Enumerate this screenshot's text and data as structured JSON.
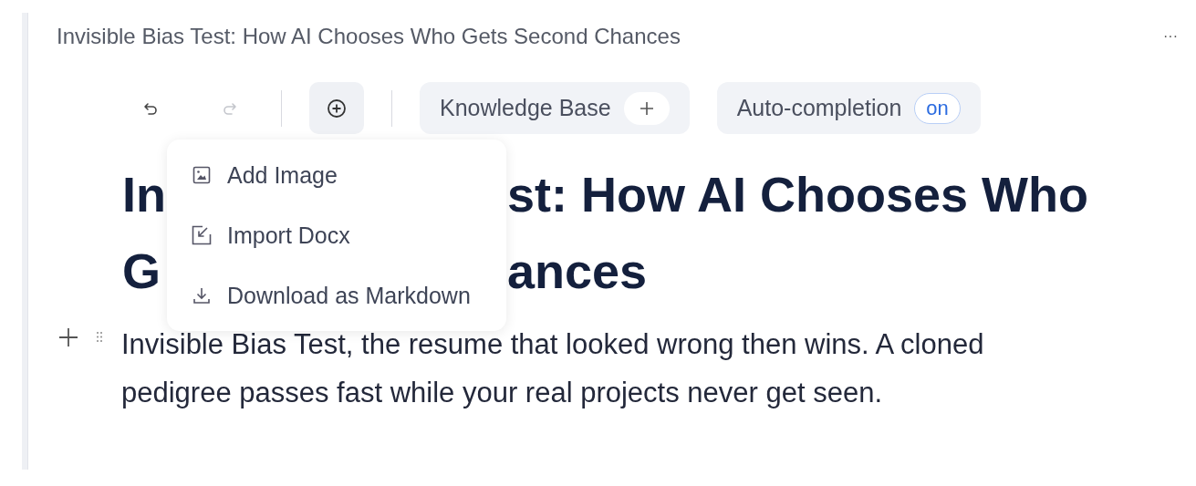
{
  "document_title": "Invisible Bias Test: How AI Chooses Who Gets Second Chances",
  "more_button": "···",
  "toolbar": {
    "undo": {
      "disabled": false
    },
    "redo": {
      "disabled": true
    },
    "knowledge_base": {
      "label": "Knowledge Base"
    },
    "auto_completion": {
      "label": "Auto-completion",
      "on": true,
      "state_text": "on"
    }
  },
  "insert_menu": {
    "expanded": true,
    "items": [
      {
        "kind": "image",
        "label": "Add Image"
      },
      {
        "kind": "import",
        "label": "Import Docx"
      },
      {
        "kind": "download",
        "label": "Download as Markdown"
      }
    ]
  },
  "heading_lines": [
    {
      "left": "In",
      "right": "st: How AI Chooses Who"
    },
    {
      "left": "G",
      "right": "ances"
    }
  ],
  "paragraph": "Invisible Bias Test, the resume that looked wrong then wins. A cloned pedigree passes fast while your real projects never get seen."
}
